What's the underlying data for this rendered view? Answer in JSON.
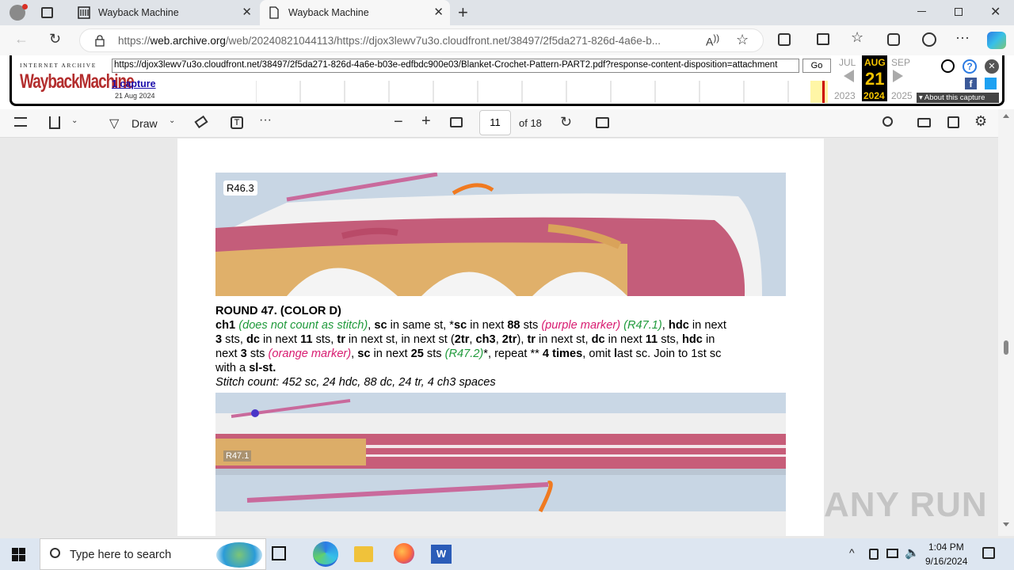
{
  "browser": {
    "tabs": [
      {
        "label": "Wayback Machine"
      },
      {
        "label": "Wayback Machine"
      }
    ],
    "url_prefix": "https://",
    "url_domain": "web.archive.org",
    "url_rest": "/web/20240821044113/https://djox3lewv7u3o.cloudfront.net/38497/2f5da271-826d-4a6e-b..."
  },
  "wayback": {
    "logo_top": "INTERNET ARCHIVE",
    "logo_main": "WaybackMachine",
    "input_url": "https://djox3lewv7u3o.cloudfront.net/38497/2f5da271-826d-4a6e-b03e-edfbdc900e03/Blanket-Crochet-Pattern-PART2.pdf?response-content-disposition=attachment",
    "go": "Go",
    "captures": "1 capture",
    "capture_date": "21 Aug 2024",
    "prev_month": "JUL",
    "cur_month": "AUG",
    "next_month": "SEP",
    "cur_day": "21",
    "prev_year": "2023",
    "cur_year": "2024",
    "next_year": "2025",
    "about": "About this capture"
  },
  "pdf_toolbar": {
    "draw": "Draw",
    "page_value": "11",
    "page_total": "of 18"
  },
  "document": {
    "photo1_label": "R46.3",
    "photo2_label": "R47.1",
    "heading": "ROUND 47. (COLOR D)",
    "l1": {
      "a": "ch1",
      "b": "(does not count as stitch)",
      "c": ", ",
      "d": "sc",
      "e": " in same st, *",
      "f": "sc",
      "g": " in next ",
      "h": "88",
      "i": " sts ",
      "j": "(purple marker)",
      "k": "(R47.1)",
      "l": ", ",
      "m": "hdc",
      "n": " in next"
    },
    "l2": {
      "a": "3",
      "b": " sts, ",
      "c": "dc",
      "d": " in next ",
      "e": "11",
      "f": " sts, ",
      "g": "tr",
      "h": " in next st, in next st (",
      "i": "2tr",
      "j": ", ",
      "k": "ch3",
      "l": ", ",
      "m": "2tr",
      "n": "), ",
      "o": "tr",
      "p": " in next st, ",
      "q": "dc",
      "r": " in next ",
      "s": "11",
      "t": " sts, ",
      "u": "hdc",
      "v": " in"
    },
    "l3": {
      "a": "next ",
      "b": "3",
      "c": " sts  ",
      "d": "(orange marker)",
      "e": ", ",
      "f": "sc",
      "g": " in next ",
      "h": "25",
      "i": " sts ",
      "j": "(R47.2)",
      "k": "*, repeat ** ",
      "l": "4 times",
      "m": ", omit ",
      "n": "l",
      "o": "ast sc",
      "p": ". Join to 1st sc"
    },
    "l4": {
      "a": "with a ",
      "b": "sl-st."
    },
    "stitch_count": "Stitch count: 452 sc, 24 hdc, 88 dc, 24 tr, 4 ch3 spaces"
  },
  "watermark": "ANY RUN",
  "taskbar": {
    "search_placeholder": "Type here to search",
    "time": "1:04 PM",
    "date": "9/16/2024"
  }
}
